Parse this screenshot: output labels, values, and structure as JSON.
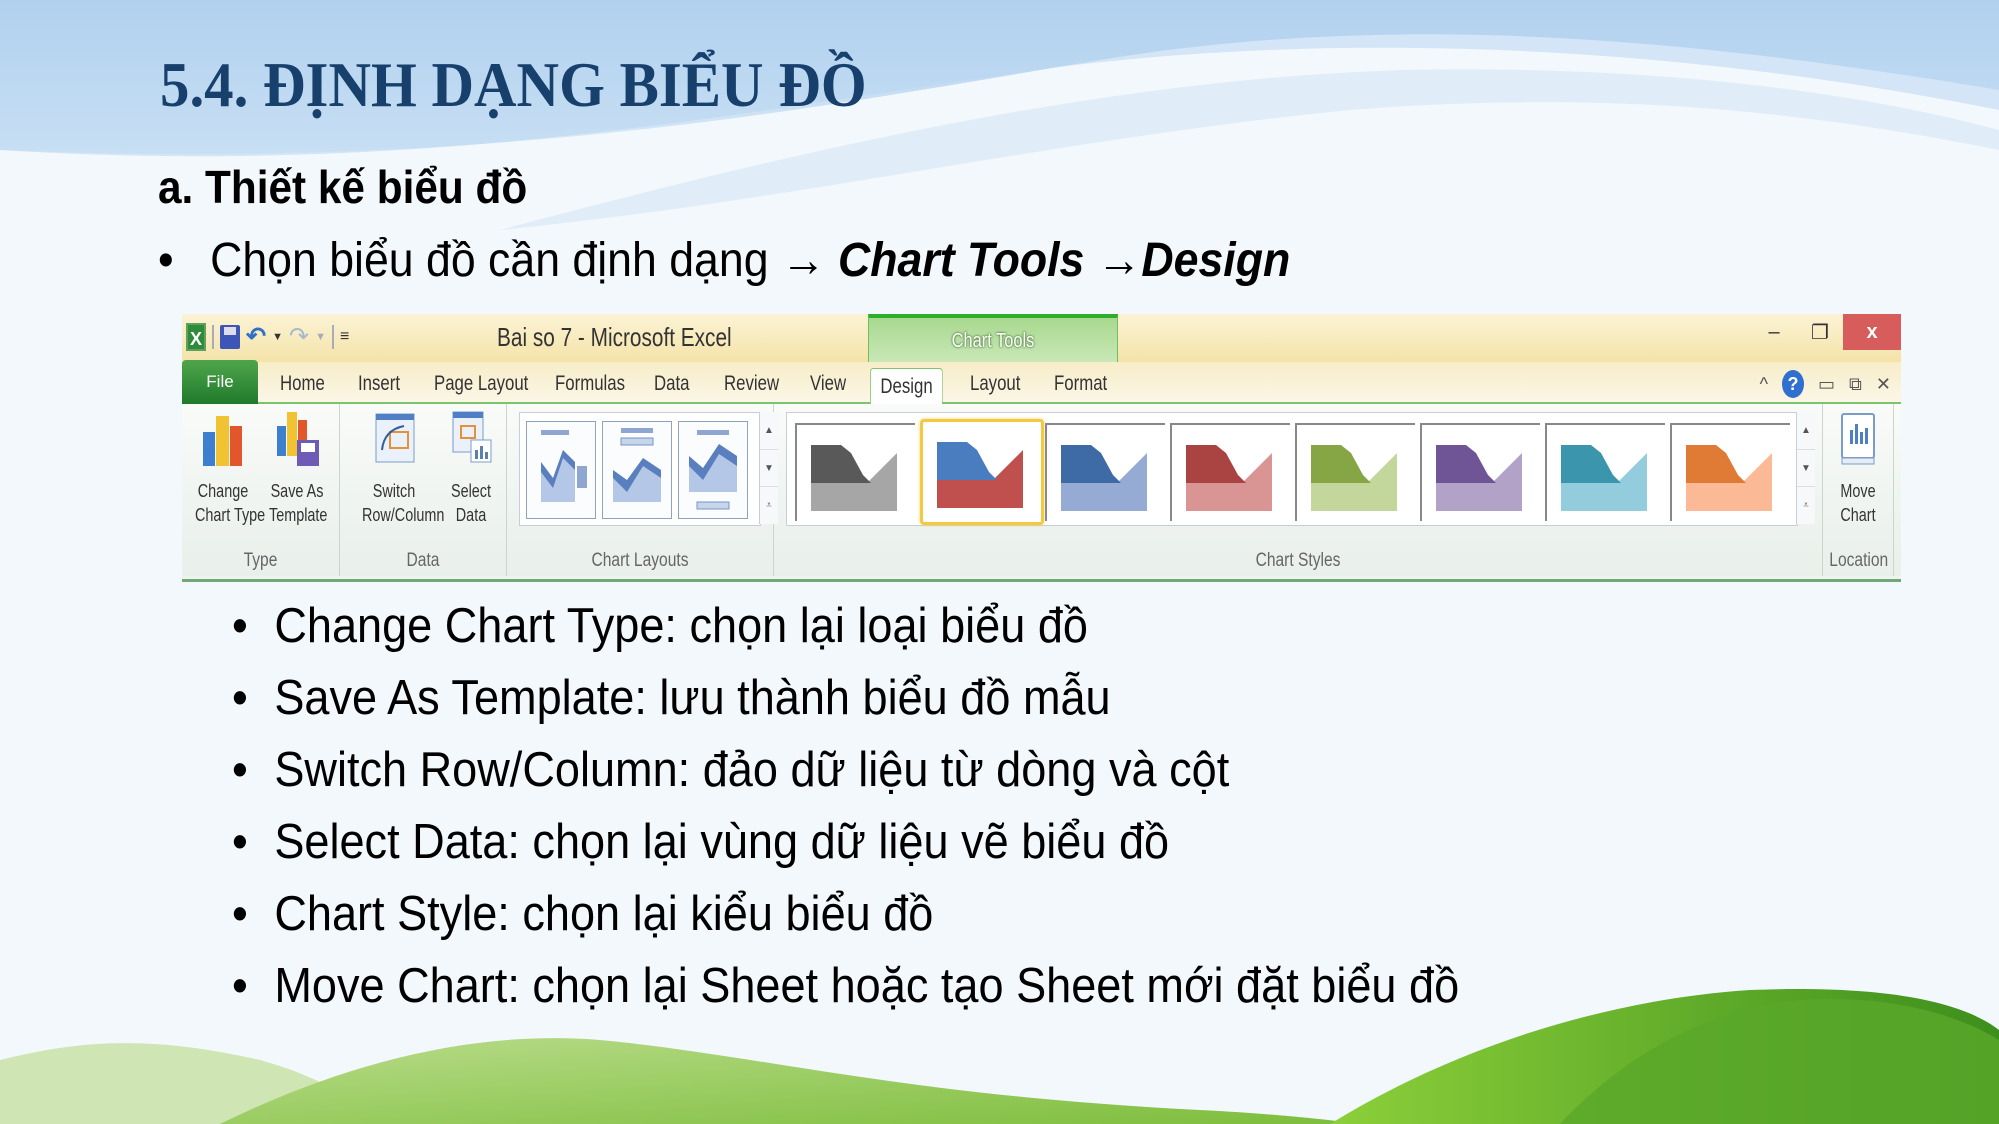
{
  "slide": {
    "title": "5.4. ĐỊNH DẠNG BIỂU ĐỒ",
    "subheading": "a. Thiết kế biểu đồ",
    "intro": {
      "bullet": "•",
      "text": "Chọn biểu đồ cần định dạng",
      "arrow1": "→",
      "em1": "Chart Tools",
      "arrow2": "→",
      "em2": "Design"
    },
    "bullets": [
      {
        "symbol": "•",
        "text": "Change Chart Type: chọn lại loại biểu đồ"
      },
      {
        "symbol": "•",
        "text": "Save As Template: lưu thành biểu đồ mẫu"
      },
      {
        "symbol": "•",
        "text": "Switch Row/Column: đảo dữ liệu từ dòng và cột"
      },
      {
        "symbol": "•",
        "text": "Select Data: chọn lại vùng dữ liệu vẽ biểu đồ"
      },
      {
        "symbol": "•",
        "text": "Chart Style: chọn lại kiểu biểu đồ"
      },
      {
        "symbol": "•",
        "text": "Move Chart: chọn lại Sheet hoặc tạo Sheet mới đặt biểu đồ"
      }
    ]
  },
  "ribbon": {
    "window_title": "Bai so 7 - Microsoft Excel",
    "quick_access": [
      "excel-icon",
      "save-icon",
      "undo-icon",
      "redo-icon",
      "customize-icon"
    ],
    "context_tab_group": "Chart Tools",
    "window_controls": {
      "minimize": "–",
      "restore": "❐",
      "close": "x"
    },
    "tabs": [
      "File",
      "Home",
      "Insert",
      "Page Layout",
      "Formulas",
      "Data",
      "Review",
      "View"
    ],
    "context_tabs": [
      "Design",
      "Layout",
      "Format"
    ],
    "active_tab": "Design",
    "help_row": {
      "collapse": "^",
      "help": "?",
      "min": "▭",
      "restore": "⧉",
      "close": "✕"
    },
    "groups": {
      "type": {
        "label": "Type",
        "buttons": [
          {
            "label1": "Change",
            "label2": "Chart Type"
          },
          {
            "label1": "Save As",
            "label2": "Template"
          }
        ]
      },
      "data": {
        "label": "Data",
        "buttons": [
          {
            "label1": "Switch",
            "label2": "Row/Column"
          },
          {
            "label1": "Select",
            "label2": "Data"
          }
        ]
      },
      "chart_layouts": {
        "label": "Chart Layouts",
        "count": 3
      },
      "chart_styles": {
        "label": "Chart Styles",
        "selected_index": 1,
        "styles": [
          {
            "dark": "#595959",
            "light": "#a6a6a6"
          },
          {
            "dark": "#4a7dbf",
            "light": "#c0504d"
          },
          {
            "dark": "#3e6aa6",
            "light": "#95abd3"
          },
          {
            "dark": "#a94442",
            "light": "#d99594"
          },
          {
            "dark": "#86a545",
            "light": "#c3d69b"
          },
          {
            "dark": "#6f5595",
            "light": "#b2a2c7"
          },
          {
            "dark": "#3a95ad",
            "light": "#93cddd"
          },
          {
            "dark": "#e07b35",
            "light": "#fbb995"
          }
        ]
      },
      "location": {
        "label": "Location",
        "button": {
          "label1": "Move",
          "label2": "Chart"
        }
      }
    }
  },
  "colors": {
    "title": "#17406d",
    "active_tab_accent": "#2cae2c",
    "file_tab": "#2e8b3a",
    "close_button": "#d75c5c",
    "selected_style_border": "#f5c842"
  }
}
